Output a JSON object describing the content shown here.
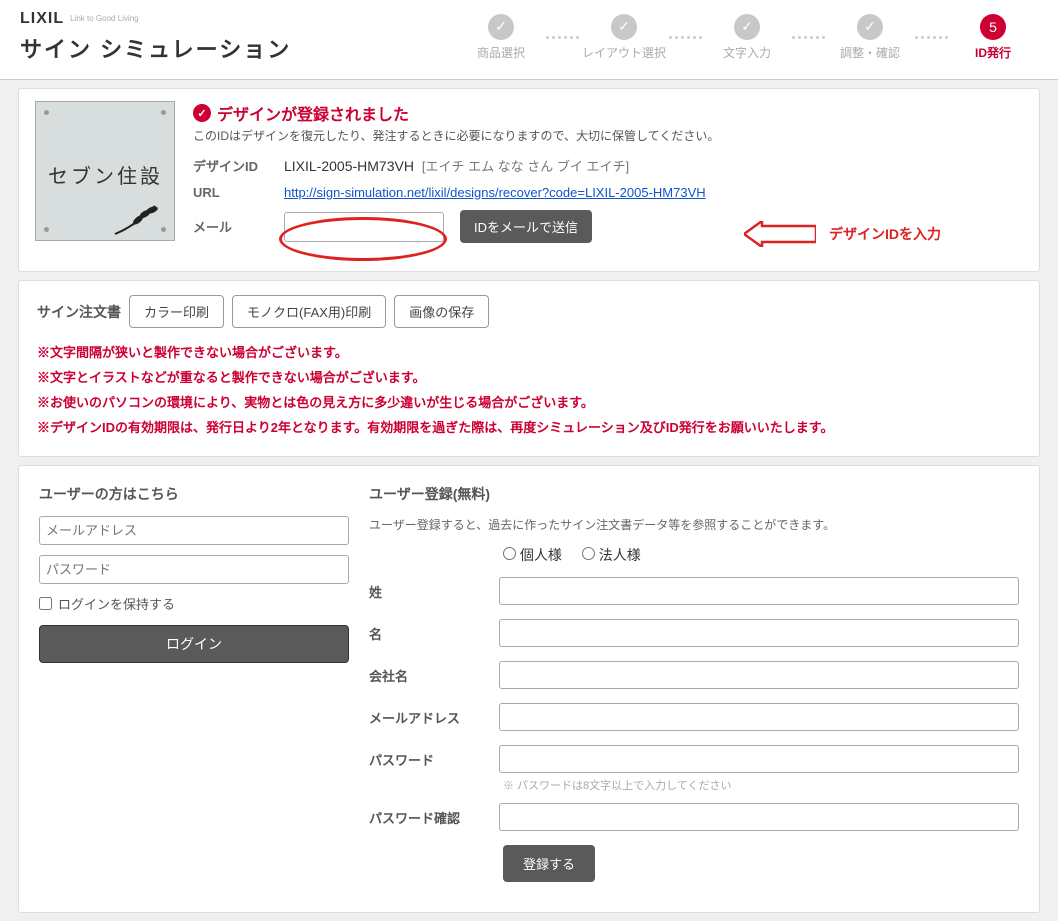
{
  "brand": {
    "logo_text": "LIXIL",
    "tagline": "Link to\nGood Living",
    "title": "サイン シミュレーション"
  },
  "steps": [
    {
      "label": "商品選択"
    },
    {
      "label": "レイアウト選択"
    },
    {
      "label": "文字入力"
    },
    {
      "label": "調整・確認"
    },
    {
      "label": "ID発行",
      "num": "5",
      "active": true
    }
  ],
  "success": {
    "title": "デザインが登録されました",
    "desc": "このIDはデザインを復元したり、発注するときに必要になりますので、大切に保管してください。"
  },
  "thumb_text": "セブン住設",
  "fields": {
    "design_id_label": "デザインID",
    "design_id": "LIXIL-2005-HM73VH",
    "design_reading": "[エイチ エム なな さん ブイ エイチ]",
    "url_label": "URL",
    "url": "http://sign-simulation.net/lixil/designs/recover?code=LIXIL-2005-HM73VH",
    "mail_label": "メール",
    "send_btn": "IDをメールで送信"
  },
  "annotation": "デザインIDを入力",
  "docs": {
    "label": "サイン注文書",
    "btns": [
      "カラー印刷",
      "モノクロ(FAX用)印刷",
      "画像の保存"
    ]
  },
  "notes": [
    "※文字間隔が狭いと製作できない場合がございます。",
    "※文字とイラストなどが重なると製作できない場合がございます。",
    "※お使いのパソコンの環境により、実物とは色の見え方に多少違いが生じる場合がございます。",
    "※デザインIDの有効期限は、発行日より2年となります。有効期限を過ぎた際は、再度シミュレーション及びID発行をお願いいたします。"
  ],
  "login": {
    "title": "ユーザーの方はこちら",
    "email_ph": "メールアドレス",
    "password_ph": "パスワード",
    "keep": "ログインを保持する",
    "btn": "ログイン"
  },
  "register": {
    "title": "ユーザー登録(無料)",
    "desc": "ユーザー登録すると、過去に作ったサイン注文書データ等を参照することができます。",
    "radio_personal": "個人様",
    "radio_corp": "法人様",
    "last_name": "姓",
    "first_name": "名",
    "company": "会社名",
    "email": "メールアドレス",
    "password": "パスワード",
    "pw_note": "※ パスワードは8文字以上で入力してください",
    "password_conf": "パスワード確認",
    "btn": "登録する"
  }
}
